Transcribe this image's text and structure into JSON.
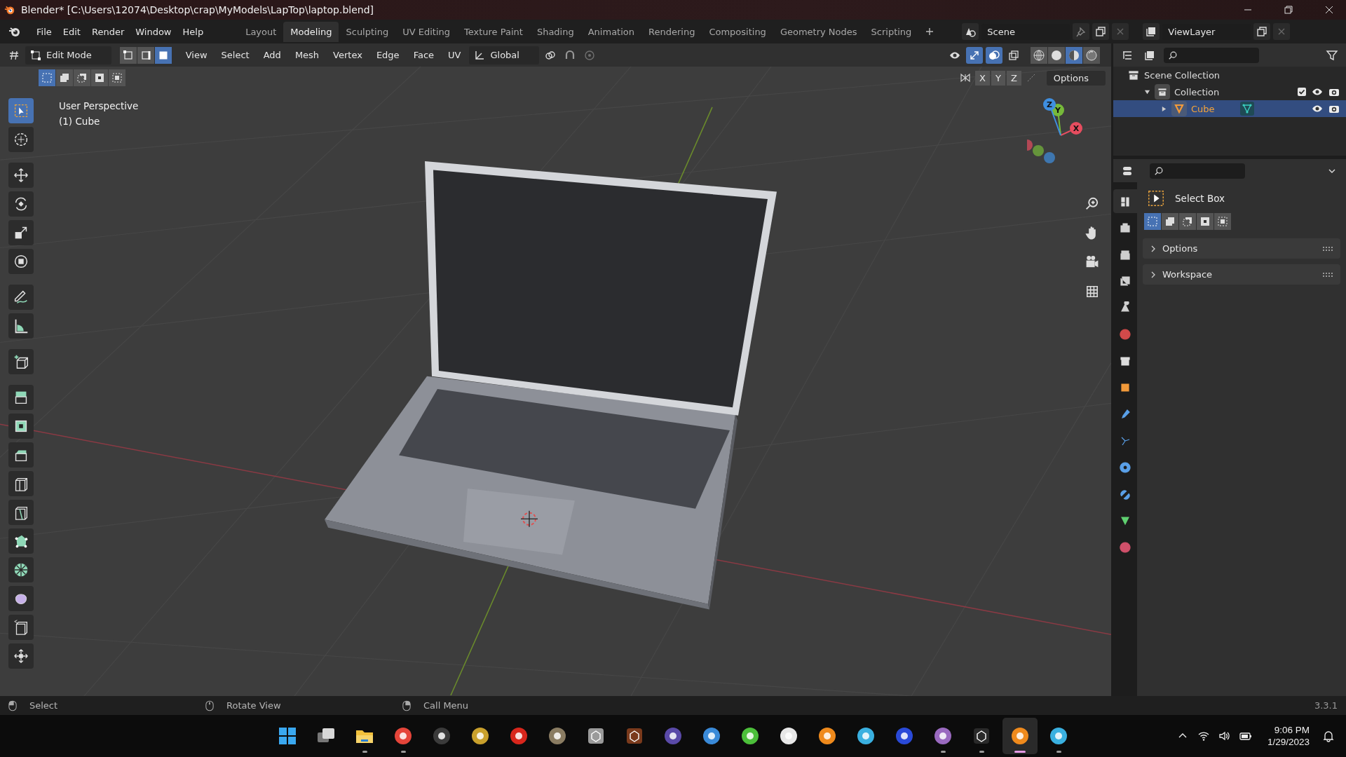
{
  "window": {
    "title": "Blender* [C:\\Users\\12074\\Desktop\\crap\\MyModels\\LapTop\\laptop.blend]"
  },
  "menu": [
    "File",
    "Edit",
    "Render",
    "Window",
    "Help"
  ],
  "workspace_tabs": [
    {
      "label": "Layout",
      "selected": false
    },
    {
      "label": "Modeling",
      "selected": true
    },
    {
      "label": "Sculpting",
      "selected": false
    },
    {
      "label": "UV Editing",
      "selected": false
    },
    {
      "label": "Texture Paint",
      "selected": false
    },
    {
      "label": "Shading",
      "selected": false
    },
    {
      "label": "Animation",
      "selected": false
    },
    {
      "label": "Rendering",
      "selected": false
    },
    {
      "label": "Compositing",
      "selected": false
    },
    {
      "label": "Geometry Nodes",
      "selected": false
    },
    {
      "label": "Scripting",
      "selected": false
    }
  ],
  "scene": {
    "name": "Scene"
  },
  "view_layer": {
    "name": "ViewLayer"
  },
  "viewport_header": {
    "mode": "Edit Mode",
    "select_modes": [
      {
        "kind": "vertex",
        "selected": false
      },
      {
        "kind": "edge",
        "selected": false
      },
      {
        "kind": "face",
        "selected": true
      }
    ],
    "menus": [
      "View",
      "Select",
      "Add",
      "Mesh",
      "Vertex",
      "Edge",
      "Face",
      "UV"
    ],
    "orientation": "Global",
    "gizmos_on": true,
    "overlays_on": true,
    "xray_on": false,
    "shading_modes": [
      {
        "kind": "wireframe",
        "selected": false
      },
      {
        "kind": "solid",
        "selected": false
      },
      {
        "kind": "material",
        "selected": true
      },
      {
        "kind": "rendered",
        "selected": false
      }
    ]
  },
  "box_modes": [
    {
      "selected": true
    },
    {
      "selected": false
    },
    {
      "selected": false
    },
    {
      "selected": false
    },
    {
      "selected": false
    }
  ],
  "tool_header": {
    "axes": [
      "X",
      "Y",
      "Z"
    ],
    "options": "Options"
  },
  "viewport": {
    "info": [
      "User Perspective",
      "(1) Cube"
    ]
  },
  "gizmo": {
    "axes": [
      {
        "label": "X",
        "color": "#e64d5f"
      },
      {
        "label": "Y",
        "color": "#76b93a"
      },
      {
        "label": "Z",
        "color": "#3f8fe0"
      }
    ]
  },
  "tools": [
    {
      "kind": "select",
      "selected": true
    },
    {
      "kind": "cursor",
      "selected": false
    },
    {
      "kind": "move",
      "selected": false
    },
    {
      "kind": "rotate",
      "selected": false
    },
    {
      "kind": "scale",
      "selected": false
    },
    {
      "kind": "transform",
      "selected": false
    },
    {
      "kind": "annotate",
      "selected": false
    },
    {
      "kind": "measure",
      "selected": false
    },
    {
      "kind": "add-cube",
      "selected": false
    },
    {
      "kind": "extrude",
      "selected": false
    },
    {
      "kind": "inset",
      "selected": false
    },
    {
      "kind": "bevel",
      "selected": false
    },
    {
      "kind": "loop-cut",
      "selected": false
    },
    {
      "kind": "knife",
      "selected": false
    },
    {
      "kind": "poly-build",
      "selected": false
    },
    {
      "kind": "spin",
      "selected": false
    },
    {
      "kind": "smooth",
      "selected": false
    },
    {
      "kind": "edge-slide",
      "selected": false
    },
    {
      "kind": "shrink",
      "selected": false
    }
  ],
  "outliner": {
    "items": [
      {
        "label": "Scene Collection",
        "kind": "scene-collection",
        "children": [
          {
            "label": "Collection",
            "kind": "collection",
            "expanded": true,
            "checked": true,
            "selected": false,
            "children": [
              {
                "label": "Cube",
                "kind": "mesh",
                "expanded": false,
                "selected": true
              }
            ]
          }
        ]
      }
    ]
  },
  "properties": {
    "tabs": [
      {
        "kind": "tool",
        "selected": true
      },
      {
        "kind": "render",
        "selected": false
      },
      {
        "kind": "output",
        "selected": false
      },
      {
        "kind": "view-layer",
        "selected": false
      },
      {
        "kind": "scene",
        "selected": false
      },
      {
        "kind": "world",
        "selected": false
      },
      {
        "kind": "collection",
        "selected": false
      },
      {
        "kind": "object",
        "selected": false
      },
      {
        "kind": "modifier",
        "selected": false
      },
      {
        "kind": "particles",
        "selected": false
      },
      {
        "kind": "physics",
        "selected": false
      },
      {
        "kind": "constraint",
        "selected": false
      },
      {
        "kind": "data",
        "selected": false
      },
      {
        "kind": "material",
        "selected": false
      }
    ],
    "tool_name": "Select Box",
    "box_modes": [
      {
        "selected": true
      },
      {
        "selected": false
      },
      {
        "selected": false
      },
      {
        "selected": false
      },
      {
        "selected": false
      }
    ],
    "panels": [
      {
        "label": "Options",
        "expanded": false
      },
      {
        "label": "Workspace",
        "expanded": false
      }
    ]
  },
  "status_bar": {
    "hints": [
      {
        "label": "Select",
        "kind": "left"
      },
      {
        "label": "Rotate View",
        "kind": "middle"
      },
      {
        "label": "Call Menu",
        "kind": "right"
      }
    ],
    "version": "3.3.1"
  },
  "taskbar": {
    "apps": [
      {
        "kind": "start",
        "color": "#3aa8f0",
        "running": false,
        "active": false
      },
      {
        "kind": "task-view",
        "color": "#d8d8d8",
        "running": false,
        "active": false
      },
      {
        "kind": "folder",
        "color": "#f2c13c",
        "running": true,
        "active": false
      },
      {
        "kind": "round",
        "color": "#e5453a",
        "running": true,
        "active": false
      },
      {
        "kind": "round",
        "color": "#3b3b3b",
        "running": false,
        "active": false
      },
      {
        "kind": "round",
        "color": "#c9a02c",
        "running": false,
        "active": false
      },
      {
        "kind": "round",
        "color": "#d8261c",
        "running": false,
        "active": false
      },
      {
        "kind": "round",
        "color": "#8a7c62",
        "running": false,
        "active": false
      },
      {
        "kind": "square",
        "color": "#9a9a9a",
        "running": false,
        "active": false
      },
      {
        "kind": "square",
        "color": "#7a3a1c",
        "running": false,
        "active": false
      },
      {
        "kind": "round",
        "color": "#5a4aa8",
        "running": false,
        "active": false
      },
      {
        "kind": "round",
        "color": "#3a8ad8",
        "running": false,
        "active": false
      },
      {
        "kind": "round",
        "color": "#4cbf3a",
        "running": false,
        "active": false
      },
      {
        "kind": "round",
        "color": "#e8e8e8",
        "running": false,
        "active": false
      },
      {
        "kind": "round",
        "color": "#ef8a1c",
        "running": false,
        "active": false
      },
      {
        "kind": "round",
        "color": "#3ab0e0",
        "running": false,
        "active": false
      },
      {
        "kind": "round",
        "color": "#2a4ad8",
        "running": false,
        "active": false
      },
      {
        "kind": "round",
        "color": "#9a6ac0",
        "running": true,
        "active": false
      },
      {
        "kind": "square",
        "color": "#2a2a2a",
        "running": true,
        "active": false
      },
      {
        "kind": "round",
        "color": "#ef8a1c",
        "running": true,
        "active": true
      },
      {
        "kind": "round",
        "color": "#3ab0e0",
        "running": true,
        "active": false
      }
    ],
    "time": "9:06 PM",
    "date": "1/29/2023"
  }
}
